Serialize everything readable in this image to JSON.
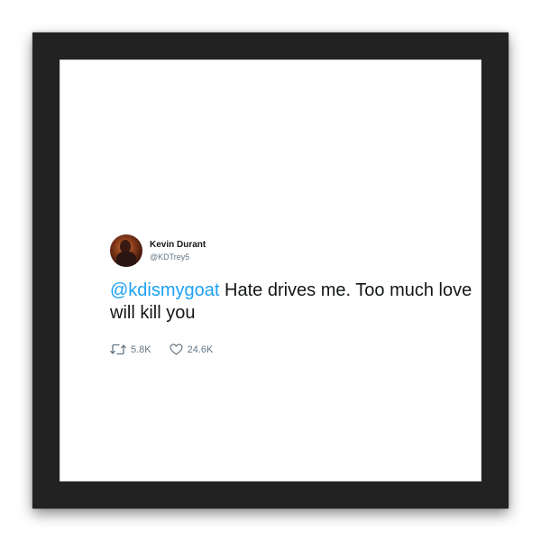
{
  "tweet": {
    "display_name": "Kevin Durant",
    "handle": "@KDTrey5",
    "mention": "@kdismygoat",
    "body": " Hate drives me. Too much love will kill you",
    "retweets": "5.8K",
    "likes": "24.6K"
  },
  "colors": {
    "frame": "#222222",
    "mention": "#1da1f2",
    "meta_text": "#657786",
    "body_text": "#14171a"
  },
  "icons": {
    "retweet": "retweet-icon",
    "like": "heart-icon"
  }
}
